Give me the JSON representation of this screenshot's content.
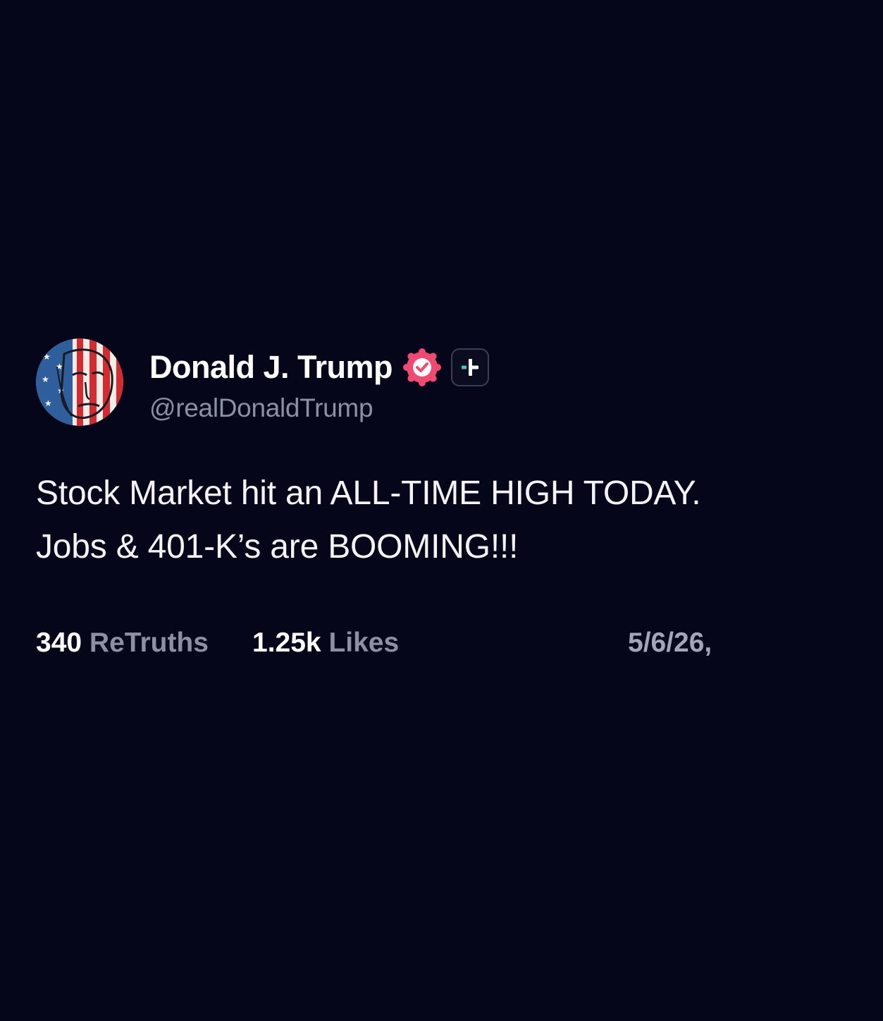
{
  "post": {
    "author": {
      "display_name": "Donald J. Trump",
      "handle": "@realDonaldTrump",
      "verified": true,
      "avatar_icon": "flag-painted-face-avatar",
      "verified_icon": "verified-check-badge-icon",
      "plus_icon": "plus-subscription-badge-icon"
    },
    "content": {
      "line1": "Stock Market hit an ALL-TIME HIGH TODAY.",
      "line2": "Jobs & 401-K’s are BOOMING!!!"
    },
    "stats": {
      "retruths_count": "340",
      "retruths_label": "ReTruths",
      "likes_count": "1.25k",
      "likes_label": "Likes",
      "timestamp": "5/6/26,"
    }
  },
  "colors": {
    "background": "#06061a",
    "text_primary": "#ffffff",
    "text_secondary": "#8d8fa3",
    "verified_badge": "#ee4a72",
    "plus_accent": "#3ec9b0"
  }
}
